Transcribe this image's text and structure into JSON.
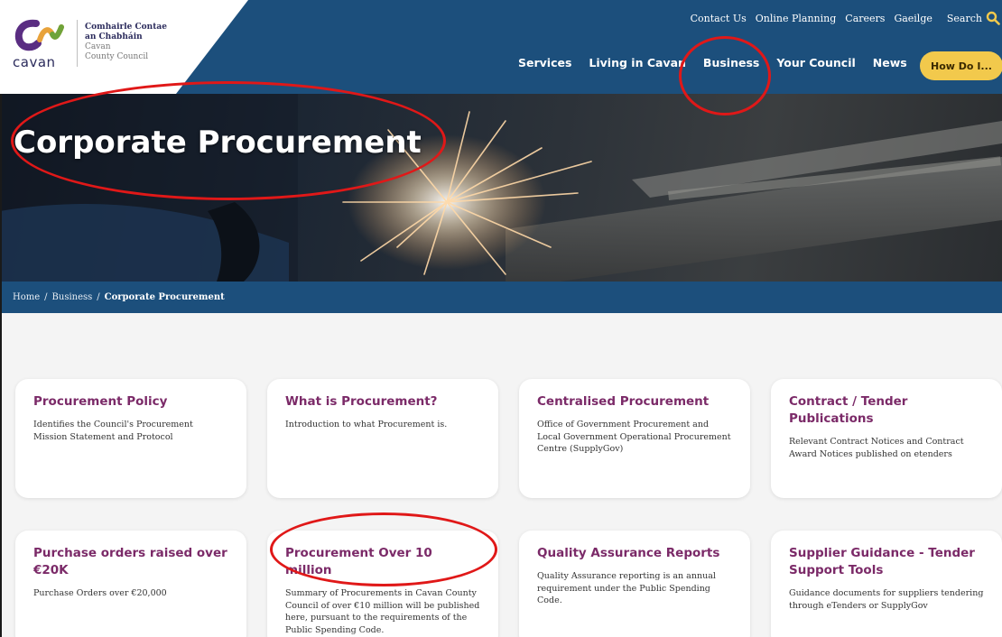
{
  "logo": {
    "word": "cavan",
    "irish_line1": "Comhairle Contae",
    "irish_line2": "an Chabháin",
    "english_line1": "Cavan",
    "english_line2": "County Council"
  },
  "util_nav": [
    "Contact Us",
    "Online Planning",
    "Careers",
    "Gaeilge"
  ],
  "search": {
    "label": "Search",
    "icon": "search-icon"
  },
  "main_nav": [
    "Services",
    "Living in Cavan",
    "Business",
    "Your Council",
    "News"
  ],
  "how_button": "How Do I...",
  "hero": {
    "title": "Corporate Procurement"
  },
  "breadcrumb": {
    "home": "Home",
    "sep": "/",
    "business": "Business",
    "current": "Corporate Procurement"
  },
  "cards": [
    {
      "title": "Procurement Policy",
      "description": "Identifies the Council's Procurement Mission Statement and Protocol"
    },
    {
      "title": "What is Procurement?",
      "description": "Introduction to what Procurement is."
    },
    {
      "title": "Centralised Procurement",
      "description": "Office of Government Procurement and Local Government Operational Procurement Centre (SupplyGov)"
    },
    {
      "title": "Contract / Tender Publications",
      "description": "Relevant Contract Notices and Contract Award Notices published on etenders"
    },
    {
      "title": "Purchase orders raised over €20K",
      "description": "Purchase Orders over €20,000"
    },
    {
      "title": "Procurement Over 10 million",
      "description": "Summary of Procurements in Cavan County Council of over €10 million will be published here, pursuant to the requirements of the Public Spending Code."
    },
    {
      "title": "Quality Assurance Reports",
      "description": "Quality Assurance reporting is an annual requirement under the Public Spending Code."
    },
    {
      "title": "Supplier Guidance - Tender Support Tools",
      "description": "Guidance documents for suppliers tendering through eTenders or SupplyGov"
    }
  ],
  "colors": {
    "header_blue": "#1c4f7c",
    "card_title_purple": "#7b2a68",
    "button_yellow": "#f2c94c",
    "annotation_red": "#e01818"
  }
}
